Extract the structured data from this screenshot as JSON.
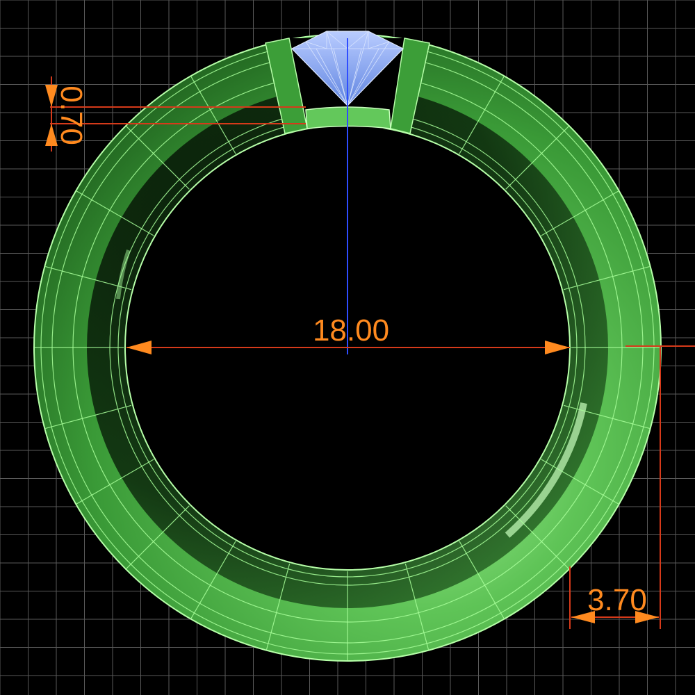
{
  "drawing": {
    "dimensions": {
      "inner_diameter": "18.00",
      "band_width": "3.70",
      "stone_seat_depth": "0.70"
    }
  },
  "colors": {
    "background": "#000000",
    "grid": "#5a5a5a",
    "ring_fill": "#4fb24a",
    "ring_highlight": "#9ff08f",
    "ring_shadow": "#0b260b",
    "wire": "#a8ff9a",
    "stone": "#8fb4ff",
    "stone_wire": "#dfe9ff",
    "dimension": "#ff8a1f",
    "dimension_line": "#d63a1a",
    "axis": "#2f4dff"
  },
  "icons": {
    "stone": "round-brilliant-diamond"
  }
}
